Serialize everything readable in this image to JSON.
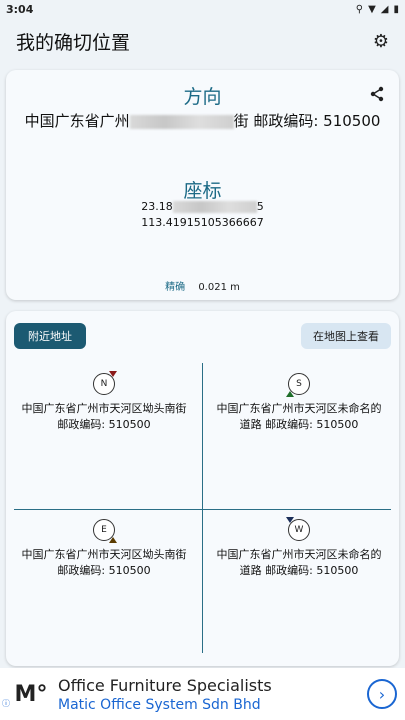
{
  "status_bar": {
    "time": "3:04",
    "icons": [
      "location-icon",
      "wifi-icon",
      "signal-icon",
      "battery-icon"
    ]
  },
  "app_bar": {
    "title": "我的确切位置",
    "settings_icon": "gear-icon"
  },
  "location_card": {
    "direction_title": "方向",
    "address_prefix": "中国广东省广州",
    "address_suffix": "街 邮政编码: 510500",
    "coordinates_title": "座标",
    "latitude_visible": "23.18",
    "latitude_tail": "5",
    "longitude": "113.41915105366667",
    "accuracy_label": "精确",
    "accuracy_value": "0.021 m"
  },
  "nearby_card": {
    "nearby_button": "附近地址",
    "map_button": "在地图上查看",
    "quadrants": [
      {
        "direction": "N",
        "address_line1": "中国广东省广州市天河区坳头南街",
        "address_line2": "邮政编码: 510500"
      },
      {
        "direction": "S",
        "address_line1": "中国广东省广州市天河区未命名的",
        "address_line2": "道路 邮政编码: 510500"
      },
      {
        "direction": "E",
        "address_line1": "中国广东省广州市天河区坳头南街",
        "address_line2": "邮政编码: 510500"
      },
      {
        "direction": "W",
        "address_line1": "中国广东省广州市天河区未命名的",
        "address_line2": "道路 邮政编码: 510500"
      }
    ]
  },
  "ad": {
    "title": "Office Furniture Specialists",
    "subtitle": "Matic Office System Sdn Bhd"
  },
  "colors": {
    "accent": "#1c6a86",
    "primary_button": "#1c5a72",
    "ad_link": "#1a66d2"
  }
}
